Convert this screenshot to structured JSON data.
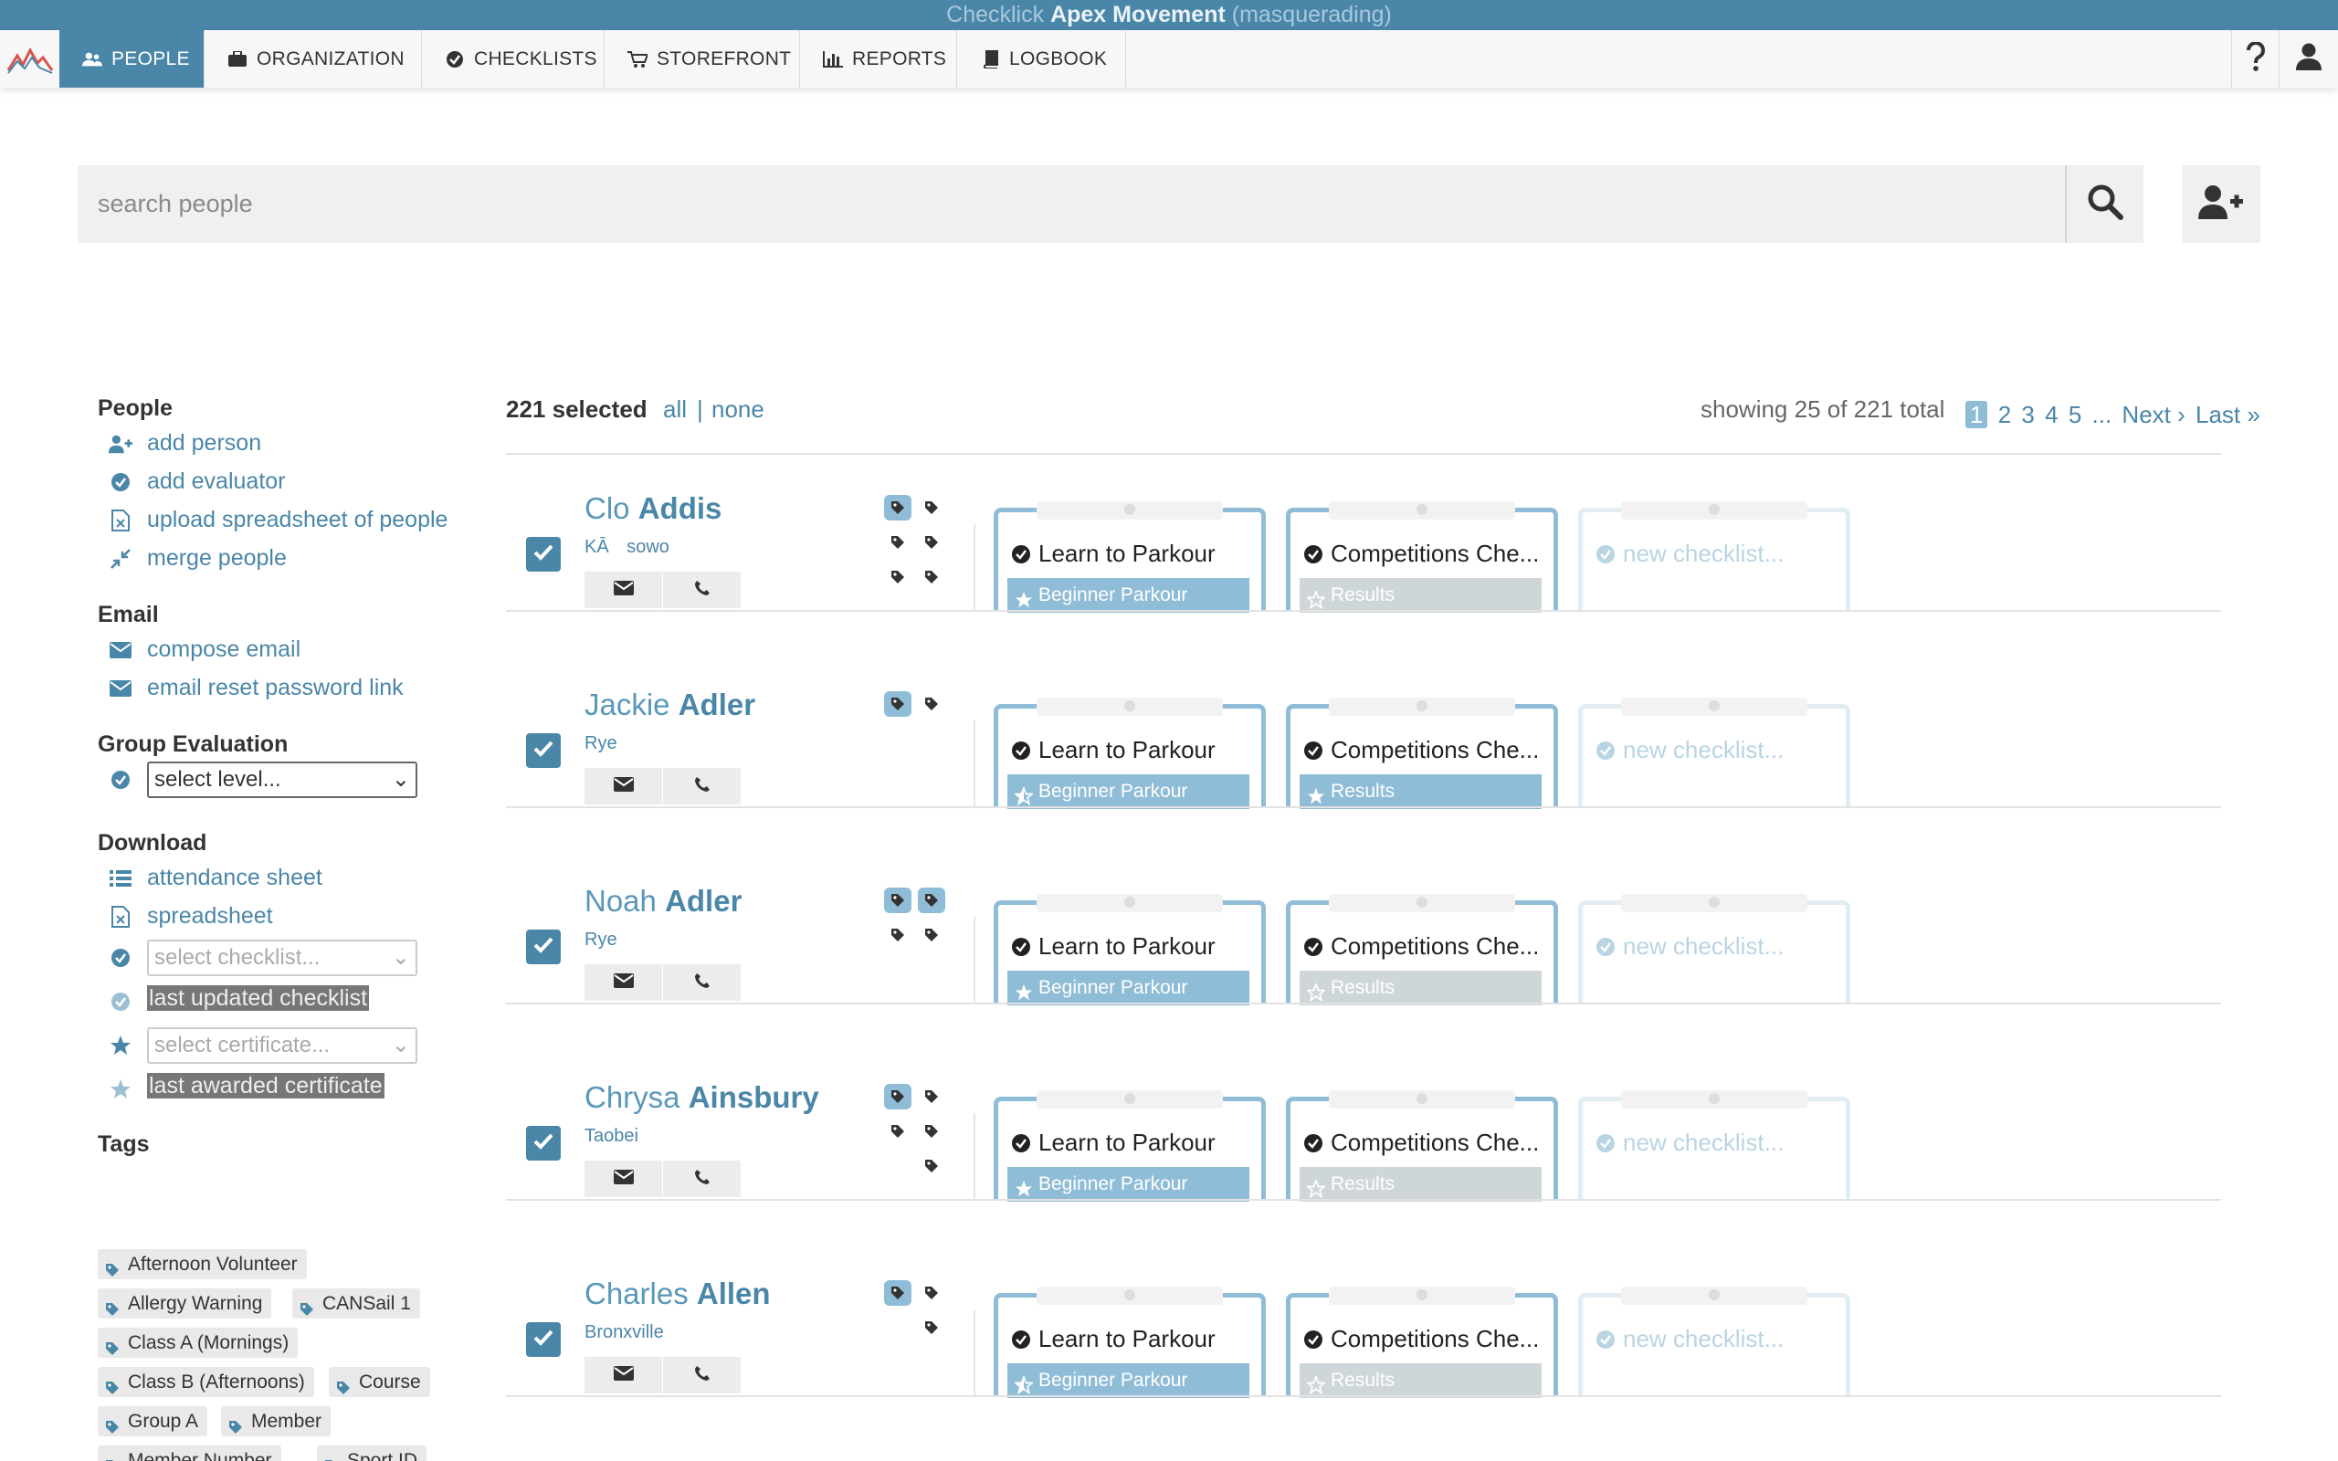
{
  "topbar": {
    "app": "Checklick",
    "org": "Apex Movement",
    "mode": "(masquerading)"
  },
  "nav": {
    "tabs": [
      {
        "label": "People",
        "icon": "users-icon",
        "active": true
      },
      {
        "label": "Organization",
        "icon": "briefcase-icon"
      },
      {
        "label": "Checklists",
        "icon": "check-circle-icon"
      },
      {
        "label": "Storefront",
        "icon": "cart-icon"
      },
      {
        "label": "Reports",
        "icon": "bar-chart-icon"
      },
      {
        "label": "Logbook",
        "icon": "book-icon"
      }
    ],
    "help_icon": "question-icon",
    "user_icon": "user-icon"
  },
  "search": {
    "placeholder": "search people"
  },
  "sidebar": {
    "people_heading": "People",
    "people_items": [
      "add person",
      "add evaluator",
      "upload spreadsheet of people",
      "merge people"
    ],
    "email_heading": "Email",
    "email_items": [
      "compose email",
      "email reset password link"
    ],
    "group_eval_heading": "Group Evaluation",
    "group_eval_select": "select level...",
    "download_heading": "Download",
    "download_items": [
      "attendance sheet",
      "spreadsheet"
    ],
    "select_checklist": "select checklist...",
    "last_updated_checklist": "last updated checklist",
    "select_certificate": "select certificate...",
    "last_awarded_certificate": "last awarded certificate",
    "tags_heading": "Tags",
    "tags": [
      "Afternoon Volunteer",
      "Allergy Warning",
      "CANSail 1",
      "Class A (Mornings)",
      "Class B (Afternoons)",
      "Course",
      "Group A",
      "Member",
      "Member Number",
      "Sport ID"
    ]
  },
  "list_header": {
    "selected": "221 selected",
    "all": "all",
    "separator": "|",
    "none": "none",
    "showing": "showing 25 of 221 total",
    "pages": [
      "1",
      "2",
      "3",
      "4",
      "5",
      "...",
      "Next ›",
      "Last »"
    ],
    "current_page": "1"
  },
  "people": [
    {
      "first": "Clo",
      "last": "Addis",
      "sub": "KĀ sowo",
      "checklist1": "Learn to Parkour",
      "badge1": "Beginner Parkour",
      "badge1_on": true,
      "checklist2": "Competitions Che...",
      "badge2": "Results",
      "badge2_on": false,
      "new_checklist": "new checklist..."
    },
    {
      "first": "Jackie",
      "last": "Adler",
      "sub": "Rye",
      "checklist1": "Learn to Parkour",
      "badge1": "Beginner Parkour",
      "badge1_on": true,
      "checklist2": "Competitions Che...",
      "badge2": "Results",
      "badge2_on": true,
      "new_checklist": "new checklist..."
    },
    {
      "first": "Noah",
      "last": "Adler",
      "sub": "Rye",
      "checklist1": "Learn to Parkour",
      "badge1": "Beginner Parkour",
      "badge1_on": true,
      "checklist2": "Competitions Che...",
      "badge2": "Results",
      "badge2_on": false,
      "new_checklist": "new checklist..."
    },
    {
      "first": "Chrysa",
      "last": "Ainsbury",
      "sub": "Taobei",
      "checklist1": "Learn to Parkour",
      "badge1": "Beginner Parkour",
      "badge1_on": true,
      "checklist2": "Competitions Che...",
      "badge2": "Results",
      "badge2_on": false,
      "new_checklist": "new checklist..."
    },
    {
      "first": "Charles",
      "last": "Allen",
      "sub": "Bronxville",
      "checklist1": "Learn to Parkour",
      "badge1": "Beginner Parkour",
      "badge1_on": true,
      "checklist2": "Competitions Che...",
      "badge2": "Results",
      "badge2_on": false,
      "new_checklist": "new checklist..."
    }
  ],
  "colors": {
    "primary": "#4a86a8",
    "accent_light": "#8fbcd6",
    "muted": "#cfd6da"
  }
}
